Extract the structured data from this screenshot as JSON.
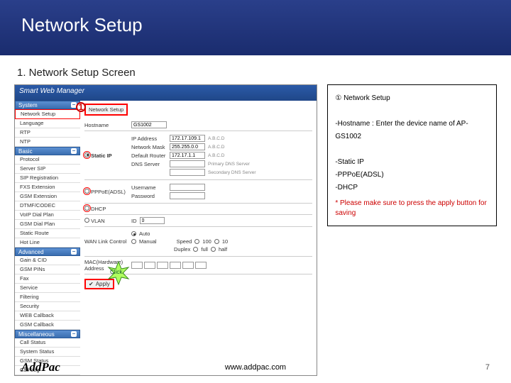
{
  "header": {
    "title": "Network Setup"
  },
  "subtitle": "1. Network Setup Screen",
  "app": {
    "banner": "Smart Web Manager",
    "sections": {
      "system": {
        "title": "System",
        "items": [
          "Network Setup",
          "Language",
          "RTP",
          "NTP"
        ]
      },
      "basic": {
        "title": "Basic",
        "items": [
          "Protocol",
          "Server SIP",
          "SIP Registration",
          "FXS Extension",
          "GSM Extension",
          "DTMF/CODEC",
          "VoIP Dial Plan",
          "GSM Dial Plan",
          "Static Route",
          "Hot Line"
        ]
      },
      "advanced": {
        "title": "Advanced",
        "items": [
          "Gain & CID",
          "GSM PINs",
          "Fax",
          "Service",
          "Filtering",
          "Security",
          "WEB Callback",
          "GSM Callback"
        ]
      },
      "misc": {
        "title": "Miscellaneous",
        "items": [
          "Call Status",
          "System Status",
          "GSM Status",
          "Call Log"
        ]
      }
    }
  },
  "form": {
    "pageTitle": "Network Setup",
    "hostname": {
      "label": "Hostname",
      "value": "GS1002"
    },
    "staticip": {
      "radio": "Static IP",
      "ip": {
        "label": "IP Address",
        "value": "172.17.109.1",
        "hint": "A.B.C.D"
      },
      "mask": {
        "label": "Network Mask",
        "value": "255.255.0.0",
        "hint": "A.B.C.D"
      },
      "router": {
        "label": "Default Router",
        "value": "172.17.1.1",
        "hint": "A.B.C.D"
      },
      "dns": {
        "label": "DNS Server",
        "p1": "Primary DNS Server",
        "p2": "Secondary DNS Server"
      }
    },
    "pppoe": {
      "radio": "PPPoE(ADSL)",
      "user": "Username",
      "pass": "Password"
    },
    "dhcp": {
      "radio": "DHCP"
    },
    "vlan": {
      "check": "VLAN",
      "idlabel": "ID",
      "idval": "0"
    },
    "wan": {
      "label": "WAN Link Control",
      "auto": "Auto",
      "manual": "Manual",
      "speed": "Speed",
      "s100": "100",
      "s10": "10",
      "duplex": "Duplex",
      "dfull": "full",
      "dhalf": "half"
    },
    "mac": {
      "label": "MAC(Hardware) Address"
    },
    "apply": "Apply",
    "click": "Click"
  },
  "info": {
    "n1": "① Network Setup",
    "host": "-Hostname : Enter the device name of AP-GS1002",
    "sip": "-Static IP",
    "pppoe": "-PPPoE(ADSL)",
    "dhcp": "-DHCP",
    "warn": "* Please make sure to press the apply button for saving"
  },
  "footer": {
    "logo": "AddPac",
    "url": "www.addpac.com",
    "page": "7"
  }
}
